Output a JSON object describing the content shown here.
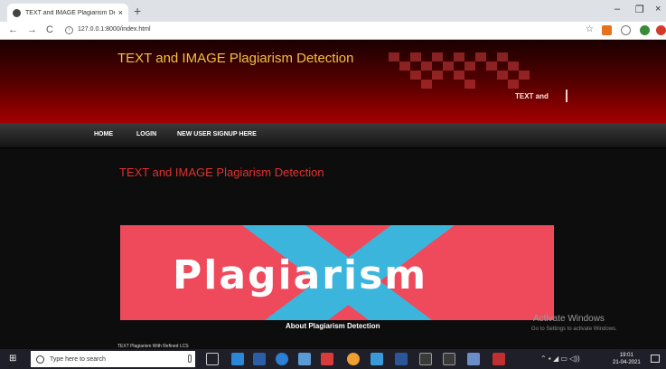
{
  "browser": {
    "tab_title": "TEXT and IMAGE Plagiarism Dete",
    "tab_close": "×",
    "new_tab": "+",
    "minimize": "–",
    "restore": "❐",
    "close": "×",
    "back": "←",
    "forward": "→",
    "reload": "C",
    "url": "127.0.0.1:8000/index.html"
  },
  "site": {
    "header_title": "TEXT and IMAGE Plagiarism Detection",
    "marquee_text": "TEXT and",
    "menu": {
      "home": "HOME",
      "login": "LOGIN",
      "signup": "NEW USER SIGNUP HERE"
    },
    "content_title": "TEXT and IMAGE Plagiarism Detection",
    "banner_word": "Plagiarism",
    "about_label": "About Plagiarism Detection",
    "footer_text": "TEXT Plagiarism With Refined LCS"
  },
  "os_watermark": {
    "title": "Activate Windows",
    "subtitle": "Go to Settings to activate Windows."
  },
  "taskbar": {
    "search_placeholder": "Type here to search",
    "time": "19:01",
    "date": "21-04-2021"
  },
  "colors": {
    "header_red": "#a50000",
    "title_gold": "#f2c23a",
    "content_title_red": "#e03030",
    "banner_pink": "#ef4a5c",
    "banner_cross": "#3bb5db"
  }
}
